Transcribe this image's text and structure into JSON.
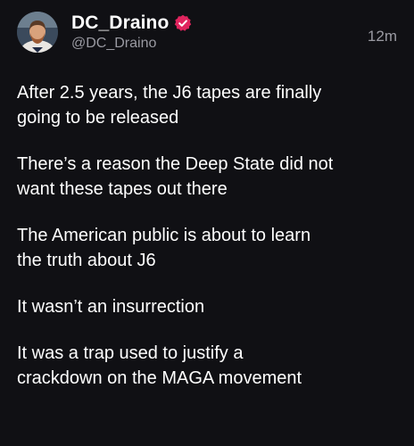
{
  "author": {
    "display_name": "DC_Draino",
    "handle": "@DC_Draino",
    "avatar_icon": "profile-photo",
    "verified_icon": "verified-badge-icon",
    "verified_color": "#e0245e"
  },
  "post": {
    "timestamp": "12m",
    "paragraphs": [
      "After 2.5 years, the J6 tapes are finally\ngoing to be released",
      "There’s a reason the Deep State did not\nwant these tapes out there",
      "The American public is about to learn\nthe truth about J6",
      "It wasn’t an insurrection",
      "It was a trap used to justify a\ncrackdown on the MAGA movement"
    ]
  },
  "colors": {
    "background": "#101014",
    "text_primary": "#ffffff",
    "text_secondary": "#9a9aa2"
  }
}
